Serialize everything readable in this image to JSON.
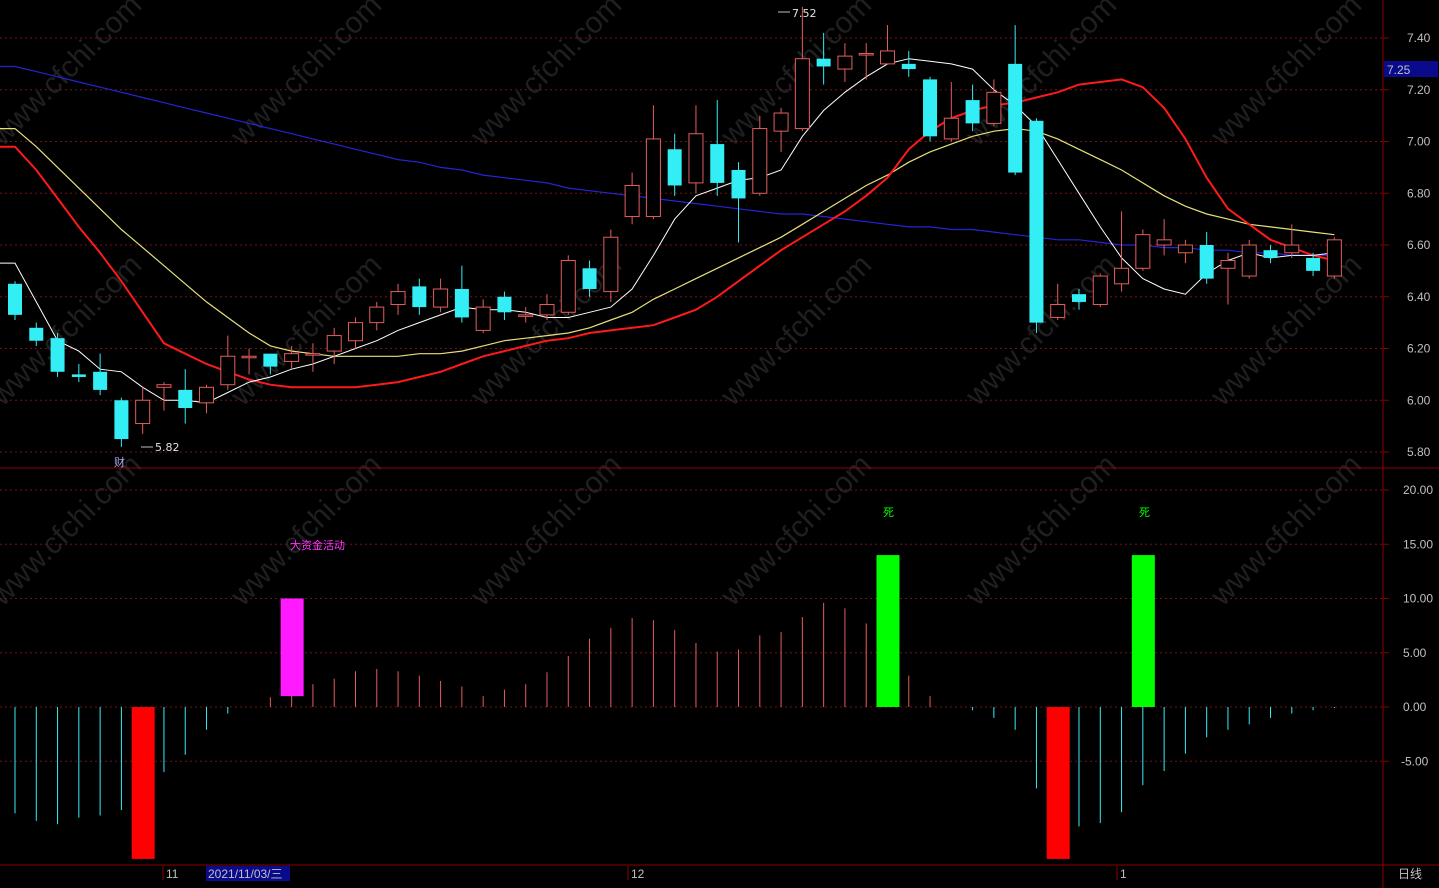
{
  "colors": {
    "background": "#000000",
    "frame": "#8b0000",
    "grid": "#7a1010",
    "up": "#e35d5d",
    "down": "#33eef5",
    "ma5": "#ffffff",
    "ma10": "#ff1a1a",
    "ma20": "#e6e07a",
    "ma60": "#2424d8",
    "bigfund": "#ff1aff",
    "death": "#00ff00",
    "negative_big": "#ff0000",
    "last_price_bg": "#0a0a8c",
    "axis_text": "#c0c0c0"
  },
  "watermark": "www.cfchi.com",
  "labels": {
    "high_annotation": "7.52",
    "low_annotation": "5.82",
    "finance_marker": "财",
    "big_fund": "大资金活动",
    "death": "死",
    "period": "日线",
    "last_price": "7.25",
    "date_box": "2021/11/03/三",
    "month_11": "11",
    "month_12": "12",
    "month_1": "1"
  },
  "chart_data": [
    {
      "type": "candlestick",
      "y_ticks": [
        "7.40",
        "7.20",
        "7.00",
        "6.80",
        "6.60",
        "6.40",
        "6.20",
        "6.00",
        "5.80"
      ],
      "ylim": [
        5.75,
        7.55
      ],
      "grid": true,
      "candles": [
        {
          "o": 6.45,
          "c": 6.33,
          "h": 6.46,
          "l": 6.31
        },
        {
          "o": 6.28,
          "c": 6.23,
          "h": 6.3,
          "l": 6.21
        },
        {
          "o": 6.24,
          "c": 6.11,
          "h": 6.26,
          "l": 6.09
        },
        {
          "o": 6.1,
          "c": 6.09,
          "h": 6.14,
          "l": 6.07
        },
        {
          "o": 6.11,
          "c": 6.04,
          "h": 6.18,
          "l": 6.02
        },
        {
          "o": 6.0,
          "c": 5.85,
          "h": 6.01,
          "l": 5.82
        },
        {
          "o": 5.91,
          "c": 6.0,
          "h": 6.05,
          "l": 5.87
        },
        {
          "o": 6.05,
          "c": 6.06,
          "h": 6.07,
          "l": 5.96
        },
        {
          "o": 6.04,
          "c": 5.97,
          "h": 6.12,
          "l": 5.91
        },
        {
          "o": 5.99,
          "c": 6.05,
          "h": 6.06,
          "l": 5.95
        },
        {
          "o": 6.06,
          "c": 6.17,
          "h": 6.25,
          "l": 6.04
        },
        {
          "o": 6.17,
          "c": 6.17,
          "h": 6.2,
          "l": 6.1
        },
        {
          "o": 6.18,
          "c": 6.13,
          "h": 6.18,
          "l": 6.1
        },
        {
          "o": 6.15,
          "c": 6.18,
          "h": 6.21,
          "l": 6.12
        },
        {
          "o": 6.18,
          "c": 6.18,
          "h": 6.22,
          "l": 6.11
        },
        {
          "o": 6.19,
          "c": 6.25,
          "h": 6.28,
          "l": 6.14
        },
        {
          "o": 6.23,
          "c": 6.3,
          "h": 6.32,
          "l": 6.2
        },
        {
          "o": 6.3,
          "c": 6.36,
          "h": 6.38,
          "l": 6.27
        },
        {
          "o": 6.37,
          "c": 6.42,
          "h": 6.45,
          "l": 6.33
        },
        {
          "o": 6.44,
          "c": 6.36,
          "h": 6.47,
          "l": 6.33
        },
        {
          "o": 6.36,
          "c": 6.43,
          "h": 6.47,
          "l": 6.34
        },
        {
          "o": 6.43,
          "c": 6.32,
          "h": 6.52,
          "l": 6.3
        },
        {
          "o": 6.27,
          "c": 6.36,
          "h": 6.39,
          "l": 6.26
        },
        {
          "o": 6.4,
          "c": 6.34,
          "h": 6.42,
          "l": 6.31
        },
        {
          "o": 6.33,
          "c": 6.33,
          "h": 6.36,
          "l": 6.3
        },
        {
          "o": 6.33,
          "c": 6.37,
          "h": 6.41,
          "l": 6.31
        },
        {
          "o": 6.34,
          "c": 6.54,
          "h": 6.56,
          "l": 6.33
        },
        {
          "o": 6.51,
          "c": 6.43,
          "h": 6.54,
          "l": 6.4
        },
        {
          "o": 6.42,
          "c": 6.63,
          "h": 6.66,
          "l": 6.38
        },
        {
          "o": 6.71,
          "c": 6.83,
          "h": 6.88,
          "l": 6.68
        },
        {
          "o": 6.71,
          "c": 7.01,
          "h": 7.14,
          "l": 6.7
        },
        {
          "o": 6.97,
          "c": 6.83,
          "h": 7.03,
          "l": 6.79
        },
        {
          "o": 6.84,
          "c": 7.03,
          "h": 7.14,
          "l": 6.8
        },
        {
          "o": 6.99,
          "c": 6.84,
          "h": 7.16,
          "l": 6.79
        },
        {
          "o": 6.89,
          "c": 6.78,
          "h": 6.92,
          "l": 6.61
        },
        {
          "o": 6.8,
          "c": 7.05,
          "h": 7.1,
          "l": 6.79
        },
        {
          "o": 7.04,
          "c": 7.11,
          "h": 7.13,
          "l": 6.96
        },
        {
          "o": 7.05,
          "c": 7.32,
          "h": 7.52,
          "l": 7.04
        },
        {
          "o": 7.32,
          "c": 7.29,
          "h": 7.42,
          "l": 7.22
        },
        {
          "o": 7.28,
          "c": 7.33,
          "h": 7.38,
          "l": 7.23
        },
        {
          "o": 7.34,
          "c": 7.34,
          "h": 7.38,
          "l": 7.24
        },
        {
          "o": 7.3,
          "c": 7.35,
          "h": 7.45,
          "l": 7.3
        },
        {
          "o": 7.3,
          "c": 7.28,
          "h": 7.35,
          "l": 7.25
        },
        {
          "o": 7.24,
          "c": 7.02,
          "h": 7.25,
          "l": 7.0
        },
        {
          "o": 7.01,
          "c": 7.09,
          "h": 7.23,
          "l": 7.0
        },
        {
          "o": 7.16,
          "c": 7.07,
          "h": 7.22,
          "l": 7.04
        },
        {
          "o": 7.07,
          "c": 7.19,
          "h": 7.24,
          "l": 7.06
        },
        {
          "o": 7.3,
          "c": 6.88,
          "h": 7.45,
          "l": 6.87
        },
        {
          "o": 7.08,
          "c": 6.3,
          "h": 7.09,
          "l": 6.26
        },
        {
          "o": 6.32,
          "c": 6.37,
          "h": 6.45,
          "l": 6.31
        },
        {
          "o": 6.41,
          "c": 6.38,
          "h": 6.43,
          "l": 6.35
        },
        {
          "o": 6.37,
          "c": 6.48,
          "h": 6.49,
          "l": 6.36
        },
        {
          "o": 6.45,
          "c": 6.51,
          "h": 6.73,
          "l": 6.42
        },
        {
          "o": 6.51,
          "c": 6.64,
          "h": 6.66,
          "l": 6.5
        },
        {
          "o": 6.6,
          "c": 6.62,
          "h": 6.7,
          "l": 6.56
        },
        {
          "o": 6.57,
          "c": 6.6,
          "h": 6.62,
          "l": 6.53
        },
        {
          "o": 6.6,
          "c": 6.47,
          "h": 6.65,
          "l": 6.45
        },
        {
          "o": 6.51,
          "c": 6.54,
          "h": 6.57,
          "l": 6.37
        },
        {
          "o": 6.48,
          "c": 6.6,
          "h": 6.62,
          "l": 6.47
        },
        {
          "o": 6.58,
          "c": 6.55,
          "h": 6.6,
          "l": 6.53
        },
        {
          "o": 6.57,
          "c": 6.6,
          "h": 6.68,
          "l": 6.55
        },
        {
          "o": 6.55,
          "c": 6.5,
          "h": 6.57,
          "l": 6.48
        },
        {
          "o": 6.48,
          "c": 6.62,
          "h": 6.63,
          "l": 6.47
        }
      ],
      "ma_series": [
        {
          "key": "ma60",
          "values": [
            7.29,
            7.27,
            7.25,
            7.23,
            7.21,
            7.19,
            7.17,
            7.15,
            7.13,
            7.11,
            7.09,
            7.07,
            7.05,
            7.03,
            7.01,
            6.99,
            6.97,
            6.95,
            6.93,
            6.92,
            6.9,
            6.89,
            6.87,
            6.86,
            6.85,
            6.84,
            6.82,
            6.81,
            6.8,
            6.79,
            6.78,
            6.77,
            6.76,
            6.75,
            6.74,
            6.73,
            6.72,
            6.72,
            6.71,
            6.7,
            6.69,
            6.68,
            6.67,
            6.67,
            6.66,
            6.66,
            6.65,
            6.64,
            6.63,
            6.62,
            6.62,
            6.61,
            6.6,
            6.6,
            6.59,
            6.59,
            6.58,
            6.58,
            6.57,
            6.57,
            6.56,
            6.56,
            6.56
          ]
        },
        {
          "key": "ma20",
          "values": [
            7.05,
            6.98,
            6.9,
            6.82,
            6.74,
            6.66,
            6.59,
            6.52,
            6.45,
            6.38,
            6.32,
            6.26,
            6.21,
            6.19,
            6.18,
            6.17,
            6.17,
            6.17,
            6.17,
            6.18,
            6.18,
            6.19,
            6.21,
            6.23,
            6.24,
            6.25,
            6.26,
            6.28,
            6.31,
            6.34,
            6.39,
            6.43,
            6.47,
            6.51,
            6.55,
            6.59,
            6.63,
            6.68,
            6.73,
            6.78,
            6.83,
            6.87,
            6.92,
            6.96,
            6.99,
            7.02,
            7.04,
            7.05,
            7.04,
            7.01,
            6.97,
            6.93,
            6.89,
            6.84,
            6.79,
            6.75,
            6.72,
            6.7,
            6.68,
            6.67,
            6.66,
            6.65,
            6.64
          ]
        },
        {
          "key": "ma10",
          "values": [
            6.98,
            6.89,
            6.78,
            6.67,
            6.57,
            6.46,
            6.34,
            6.22,
            6.18,
            6.14,
            6.11,
            6.08,
            6.06,
            6.05,
            6.05,
            6.05,
            6.05,
            6.06,
            6.07,
            6.09,
            6.11,
            6.14,
            6.17,
            6.19,
            6.21,
            6.23,
            6.24,
            6.26,
            6.27,
            6.28,
            6.29,
            6.32,
            6.35,
            6.4,
            6.46,
            6.52,
            6.58,
            6.63,
            6.68,
            6.73,
            6.79,
            6.86,
            6.97,
            7.04,
            7.09,
            7.12,
            7.14,
            7.15,
            7.17,
            7.19,
            7.22,
            7.23,
            7.24,
            7.21,
            7.13,
            7.01,
            6.86,
            6.74,
            6.68,
            6.62,
            6.59,
            6.56,
            6.54
          ]
        },
        {
          "key": "ma5",
          "values": [
            6.53,
            6.38,
            6.23,
            6.19,
            6.12,
            6.11,
            6.05,
            6.0,
            6.0,
            5.99,
            6.03,
            6.07,
            6.09,
            6.12,
            6.14,
            6.17,
            6.2,
            6.23,
            6.27,
            6.3,
            6.33,
            6.36,
            6.35,
            6.35,
            6.34,
            6.32,
            6.32,
            6.34,
            6.36,
            6.43,
            6.56,
            6.7,
            6.79,
            6.82,
            6.85,
            6.86,
            6.89,
            7.02,
            7.12,
            7.19,
            7.25,
            7.3,
            7.32,
            7.31,
            7.3,
            7.28,
            7.2,
            7.14,
            7.06,
            6.93,
            6.8,
            6.67,
            6.55,
            6.47,
            6.43,
            6.41,
            6.49,
            6.54,
            6.57,
            6.55,
            6.56,
            6.56,
            6.57
          ]
        }
      ]
    },
    {
      "type": "bar",
      "y_ticks": [
        "20.00",
        "15.00",
        "10.00",
        "5.00",
        "0.00",
        "-5.00"
      ],
      "ylim": [
        -14.5,
        21.5
      ],
      "grid": true,
      "values": [
        -9.8,
        -10.5,
        -10.8,
        -10.2,
        -10.0,
        -9.5,
        -8.8,
        -6.0,
        -4.4,
        -2.1,
        -0.6,
        0,
        0.9,
        1.7,
        2.1,
        2.6,
        3.3,
        3.5,
        3.3,
        2.9,
        2.4,
        1.9,
        1.0,
        1.6,
        2.1,
        3.2,
        4.7,
        6.3,
        7.3,
        8.2,
        8.0,
        7.1,
        5.9,
        5.1,
        5.3,
        6.6,
        6.9,
        8.3,
        9.6,
        9.1,
        7.7,
        8.0,
        2.9,
        1.0,
        0,
        -0.3,
        -1.0,
        -2.1,
        -7.5,
        -10.9,
        -11.0,
        -10.7,
        -9.7,
        -7.2,
        -5.9,
        -4.3,
        -2.8,
        -2.1,
        -1.6,
        -1.0,
        -0.6,
        -0.3,
        -0.1
      ],
      "blocks": [
        {
          "kind": "negative_big",
          "index": 6,
          "from": 0,
          "to": -14.0
        },
        {
          "kind": "bigfund",
          "index": 13,
          "from": 10.0,
          "to": 1.0
        },
        {
          "kind": "death",
          "index": 41,
          "from": 14.0,
          "to": 0,
          "label": "死"
        },
        {
          "kind": "negative_big",
          "index": 49,
          "from": 0,
          "to": -14.0
        },
        {
          "kind": "death",
          "index": 53,
          "from": 14.0,
          "to": 0,
          "label": "死"
        }
      ]
    }
  ]
}
